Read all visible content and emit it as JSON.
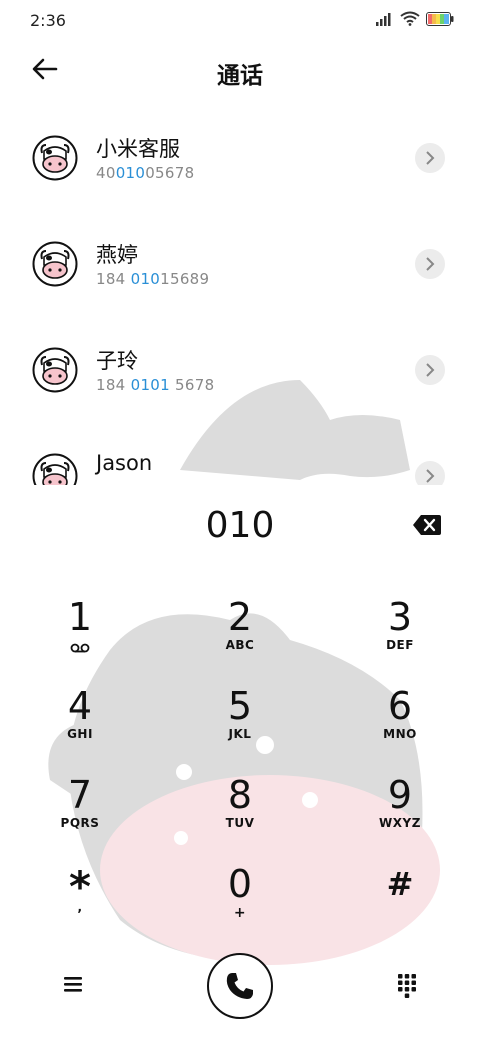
{
  "status_bar": {
    "time": "2:36"
  },
  "header": {
    "title": "通话"
  },
  "contacts": [
    {
      "name": "小米客服",
      "num_pre": "40",
      "num_hl": "010",
      "num_post": "05678"
    },
    {
      "name": "燕婷",
      "num_pre": "184 ",
      "num_hl": "010",
      "num_post": "15689"
    },
    {
      "name": "子玲",
      "num_pre": "184 ",
      "num_hl": "0101",
      "num_post": " 5678"
    },
    {
      "name": "Jason",
      "num_pre": "",
      "num_hl": "",
      "num_post": ""
    }
  ],
  "dialer": {
    "input": "010",
    "keys": [
      {
        "digit": "1",
        "sub": ""
      },
      {
        "digit": "2",
        "sub": "ABC"
      },
      {
        "digit": "3",
        "sub": "DEF"
      },
      {
        "digit": "4",
        "sub": "GHI"
      },
      {
        "digit": "5",
        "sub": "JKL"
      },
      {
        "digit": "6",
        "sub": "MNO"
      },
      {
        "digit": "7",
        "sub": "PQRS"
      },
      {
        "digit": "8",
        "sub": "TUV"
      },
      {
        "digit": "9",
        "sub": "WXYZ"
      },
      {
        "digit": "*",
        "sub": ","
      },
      {
        "digit": "0",
        "sub": "+"
      },
      {
        "digit": "#",
        "sub": ""
      }
    ]
  },
  "icons": {
    "back": "arrow-left-icon",
    "delete": "backspace-icon",
    "menu": "hamburger-icon",
    "call": "phone-icon",
    "keypad": "dialpad-icon",
    "voicemail": "voicemail-icon"
  },
  "colors": {
    "highlight": "#2a8fd6",
    "battery": "rainbow"
  }
}
